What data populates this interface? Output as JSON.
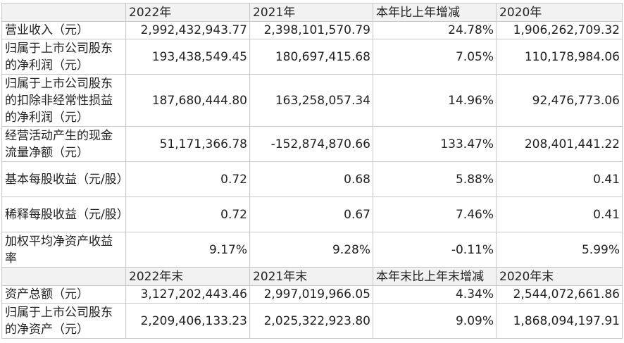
{
  "header": [
    "",
    "2022年",
    "2021年",
    "本年比上年增减",
    "2020年"
  ],
  "rows": [
    [
      "营业收入（元）",
      "2,992,432,943.77",
      "2,398,101,570.79",
      "24.78%",
      "1,906,262,709.32"
    ],
    [
      "归属于上市公司股东的净利润（元）",
      "193,438,549.45",
      "180,697,415.68",
      "7.05%",
      "110,178,984.06"
    ],
    [
      "归属于上市公司股东的扣除非经常性损益的净利润（元）",
      "187,680,444.80",
      "163,258,057.34",
      "14.96%",
      "92,476,773.06"
    ],
    [
      "经营活动产生的现金流量净额（元）",
      "51,171,366.78",
      "-152,874,870.66",
      "133.47%",
      "208,401,441.22"
    ],
    [
      "基本每股收益（元/股）",
      "0.72",
      "0.68",
      "5.88%",
      "0.41"
    ],
    [
      "稀释每股收益（元/股）",
      "0.72",
      "0.67",
      "7.46%",
      "0.41"
    ],
    [
      "加权平均净资产收益率",
      "9.17%",
      "9.28%",
      "-0.11%",
      "5.99%"
    ]
  ],
  "header2": [
    "",
    "2022年末",
    "2021年末",
    "本年末比上年末增减",
    "2020年末"
  ],
  "rows2": [
    [
      "资产总额（元）",
      "3,127,202,443.46",
      "2,997,019,966.05",
      "4.34%",
      "2,544,072,661.86"
    ],
    [
      "归属于上市公司股东的净资产（元）",
      "2,209,406,133.23",
      "2,025,322,923.80",
      "9.09%",
      "1,868,094,197.91"
    ]
  ]
}
